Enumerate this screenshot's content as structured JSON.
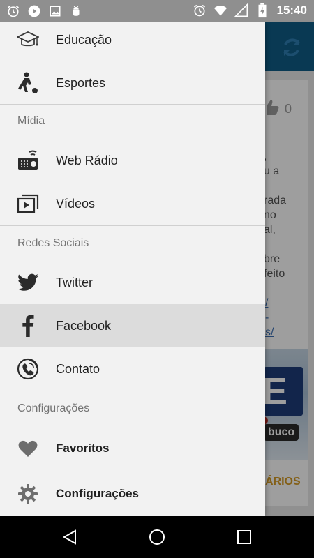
{
  "status_bar": {
    "time": "15:40",
    "left_icons": [
      "alarm-icon",
      "play-icon",
      "image-icon",
      "android-debug-icon"
    ],
    "right_icons": [
      "alarm-icon",
      "wifi-icon",
      "signal-icon",
      "battery-charging-icon"
    ]
  },
  "background_app": {
    "toolbar_color": "#0f5c87",
    "refresh_icon": "refresh-icon",
    "card": {
      "like_count": "0",
      "text_lines": [
        ",",
        "u a",
        "",
        "rada",
        "no",
        "al,",
        "",
        "bre",
        "feito"
      ],
      "link_lines": [
        "/",
        "-",
        "s/"
      ],
      "image_badge": "buco",
      "action_label": "ÁRIOS"
    }
  },
  "drawer": {
    "items_top": [
      {
        "label": "Educação",
        "icon": "graduation-cap-icon"
      },
      {
        "label": "Esportes",
        "icon": "soccer-player-icon"
      }
    ],
    "sections": [
      {
        "title": "Mídia",
        "items": [
          {
            "label": "Web Rádio",
            "icon": "radio-icon"
          },
          {
            "label": "Vídeos",
            "icon": "video-library-icon"
          }
        ]
      },
      {
        "title": "Redes Sociais",
        "items": [
          {
            "label": "Twitter",
            "icon": "twitter-icon"
          },
          {
            "label": "Facebook",
            "icon": "facebook-icon",
            "selected": true
          },
          {
            "label": "Contato",
            "icon": "phone-icon"
          }
        ]
      },
      {
        "title": "Configurações",
        "items": [
          {
            "label": "Favoritos",
            "icon": "heart-icon"
          },
          {
            "label": "Configurações",
            "icon": "gear-icon"
          }
        ]
      }
    ]
  },
  "nav_bar": {
    "buttons": [
      "back-icon",
      "home-icon",
      "recents-icon"
    ]
  },
  "colors": {
    "drawer_bg": "#f2f2f2",
    "selected_bg": "#dcdcdc",
    "section_text": "#737373",
    "accent": "#0f5c87"
  }
}
